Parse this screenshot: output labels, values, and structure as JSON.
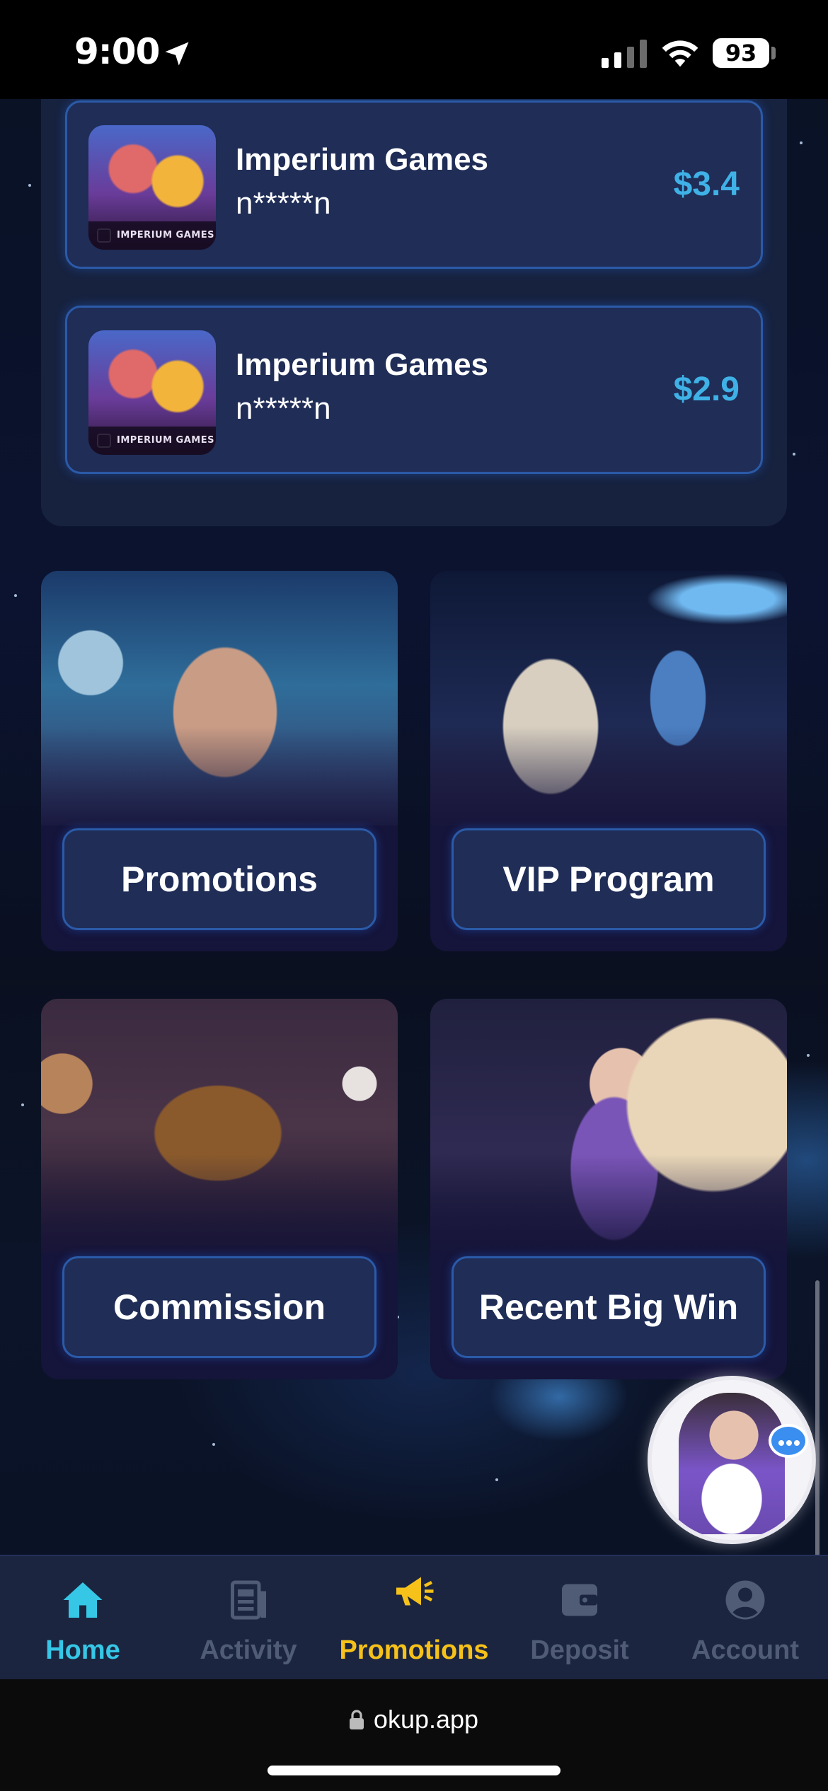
{
  "status_bar": {
    "time": "9:00",
    "battery": "93"
  },
  "recent_wins": [
    {
      "game": "Imperium Games",
      "user": "n*****n",
      "amount": "$3.4",
      "thumb_label": "IMPERIUM GAMES"
    },
    {
      "game": "Imperium Games",
      "user": "n*****n",
      "amount": "$2.9",
      "thumb_label": "IMPERIUM GAMES"
    }
  ],
  "tiles": {
    "promotions": "Promotions",
    "vip": "VIP Program",
    "commission": "Commission",
    "big_win": "Recent Big Win"
  },
  "nav": {
    "items": [
      {
        "label": "Home",
        "icon": "home-icon",
        "color": "#36c7e6"
      },
      {
        "label": "Activity",
        "icon": "document-icon",
        "color": "#505b76"
      },
      {
        "label": "Promotions",
        "icon": "megaphone-icon",
        "color": "#f6c21a"
      },
      {
        "label": "Deposit",
        "icon": "wallet-icon",
        "color": "#505b76"
      },
      {
        "label": "Account",
        "icon": "user-icon",
        "color": "#505b76"
      }
    ]
  },
  "browser": {
    "url": "okup.app"
  },
  "colors": {
    "accent_blue": "#3fb1e6",
    "promo_yellow": "#f6c21a",
    "card_bg": "#1f2d57",
    "card_border": "#2b5aa8"
  }
}
